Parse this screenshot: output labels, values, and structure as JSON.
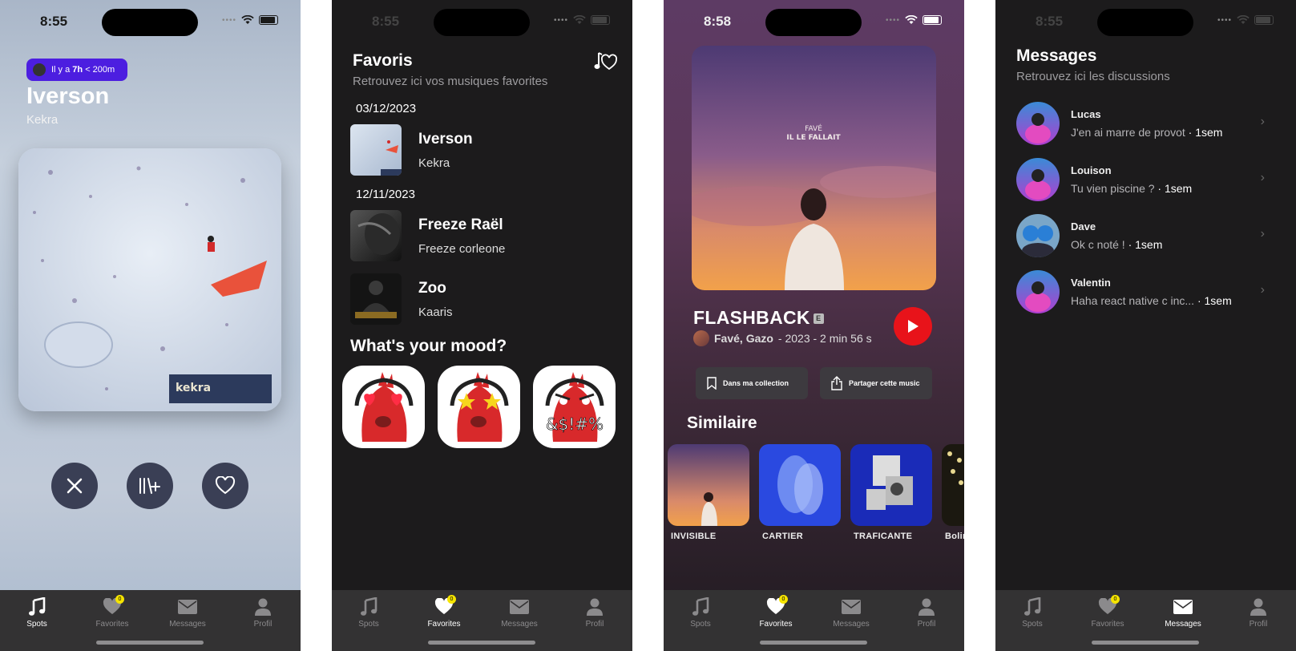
{
  "status_bar": {
    "time_1": "8:55",
    "time_2": "8:55",
    "time_3": "8:58",
    "time_4": "8:55"
  },
  "tabbar": {
    "spots": "Spots",
    "favorites": "Favorites",
    "messages": "Messages",
    "profil": "Profil",
    "badge_count": "0"
  },
  "spots": {
    "pill_text_prefix": "Il y a ",
    "pill_time": "7h",
    "pill_distance": " < 200m",
    "title": "Iverson",
    "artist": "Kekra",
    "actions": {
      "dislike": "close-icon",
      "add_playlist": "add-playlist-icon",
      "like": "heart-icon"
    }
  },
  "favorites": {
    "title": "Favoris",
    "subtitle": "Retrouvez ici vos musiques favorites",
    "groups": [
      {
        "date": "03/12/2023",
        "items": [
          {
            "title": "Iverson",
            "artist": "Kekra"
          }
        ]
      },
      {
        "date": "12/11/2023",
        "items": [
          {
            "title": "Freeze Raël",
            "artist": "Freeze corleone"
          },
          {
            "title": "Zoo",
            "artist": "Kaaris"
          }
        ]
      }
    ],
    "mood_title": "What's your mood?",
    "mood_3_text": "&$!#%"
  },
  "detail": {
    "cover_text_1": "FAVÉ",
    "cover_text_2": "IL LE FALLAIT",
    "title": "FLASHBACK",
    "explicit": "E",
    "artists": "Favé, Gazo",
    "meta": " - 2023 - 2 min 56 s",
    "collection_button": "Dans ma collection",
    "share_button": "Partager cette music",
    "similar_title": "Similaire",
    "similar": [
      "INVISIBLE",
      "CARTIER",
      "TRAFICANTE",
      "Bolin"
    ]
  },
  "messages": {
    "title": "Messages",
    "subtitle": "Retrouvez ici les discussions",
    "threads": [
      {
        "name": "Lucas",
        "preview": "J'en ai marre de provot",
        "ago": " · 1sem"
      },
      {
        "name": "Louison",
        "preview": "Tu vien piscine ?",
        "ago": " · 1sem"
      },
      {
        "name": "Dave",
        "preview": "Ok c noté !",
        "ago": " · 1sem"
      },
      {
        "name": "Valentin",
        "preview": "Haha react native c inc...",
        "ago": " · 1sem"
      }
    ]
  },
  "colors": {
    "pill": "#4c1ee0",
    "play": "#e8131a",
    "badge": "#f5e400",
    "tabbar": "#333233"
  }
}
